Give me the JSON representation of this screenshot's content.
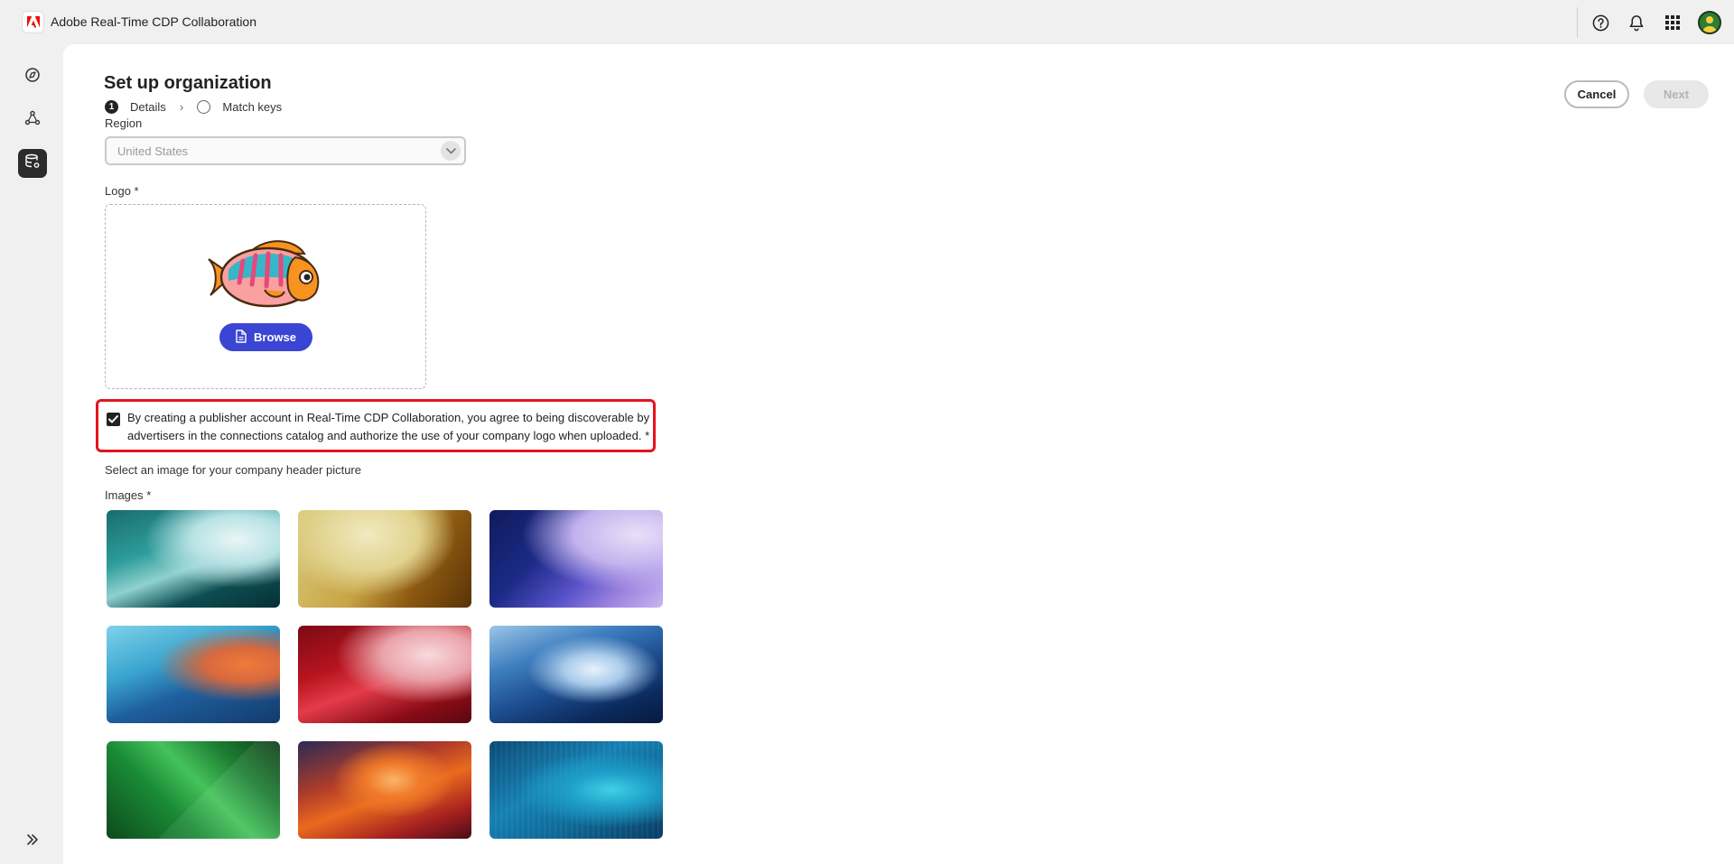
{
  "app": {
    "title": "Adobe Real-Time CDP Collaboration"
  },
  "header": {
    "help_icon": "help-icon",
    "notifications_icon": "bell-icon",
    "apps_icon": "apps-grid-icon"
  },
  "rail": {
    "items": [
      {
        "icon": "compass-icon"
      },
      {
        "icon": "network-icon"
      },
      {
        "icon": "database-settings-icon",
        "active": true
      }
    ],
    "expand_icon": "chevron-double-right-icon"
  },
  "page": {
    "title": "Set up organization",
    "steps": [
      {
        "number": "1",
        "label": "Details",
        "state": "current"
      },
      {
        "label": "Match keys",
        "state": "upcoming"
      }
    ],
    "cancel_label": "Cancel",
    "next_label": "Next"
  },
  "form": {
    "region": {
      "label": "Region",
      "value": "United States"
    },
    "logo": {
      "label": "Logo",
      "required": "*",
      "browse_label": "Browse"
    },
    "agreement": {
      "checked": true,
      "text": "By creating a publisher account in Real-Time CDP Collaboration, you agree to being discoverable by advertisers in the connections catalog and authorize the use of your company logo when uploaded. *"
    },
    "header_picture_label": "Select an image for your company header picture",
    "images": {
      "label": "Images",
      "required": "*"
    }
  },
  "colors": {
    "accent": "#3b45d4",
    "highlight_border": "#e5131e",
    "adobe_red": "#eb1000"
  }
}
